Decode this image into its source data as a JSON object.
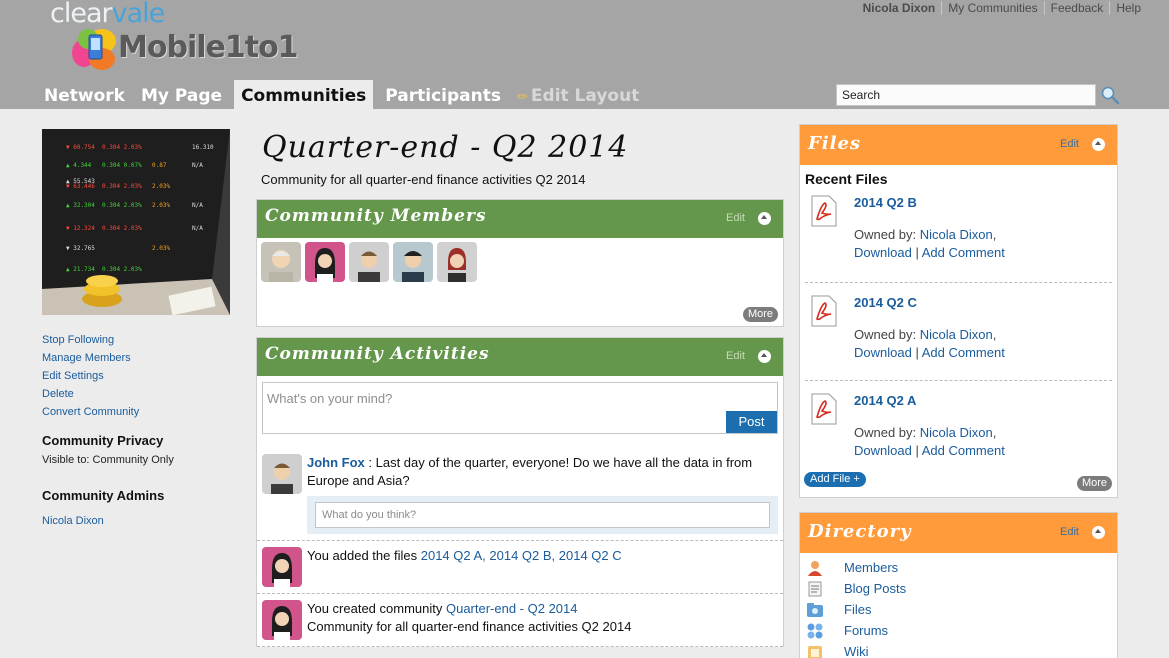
{
  "brand": {
    "top": "clear",
    "top_v": "vale",
    "main": "Mobile1to1"
  },
  "user_links": [
    "Nicola Dixon",
    "My Communities",
    "Feedback",
    "Help"
  ],
  "nav": {
    "tabs": [
      "Network",
      "My Page",
      "Communities",
      "Participants"
    ],
    "active": "Communities",
    "edit_layout": "Edit Layout"
  },
  "search": {
    "value": "Search"
  },
  "left": {
    "links": [
      "Stop Following",
      "Manage Members",
      "Edit Settings",
      "Delete",
      "Convert Community"
    ],
    "privacy_title": "Community Privacy",
    "privacy_value": "Visible to: Community Only",
    "admins_title": "Community Admins",
    "admin": "Nicola Dixon"
  },
  "community": {
    "title": "Quarter-end - Q2 2014",
    "subtitle": "Community for all quarter-end finance activities Q2 2014"
  },
  "members_panel": {
    "title": "Community Members",
    "edit": "Edit",
    "more": "More"
  },
  "activities_panel": {
    "title": "Community Activities",
    "edit": "Edit",
    "composer_placeholder": "What's on your mind?",
    "post_label": "Post",
    "reply_placeholder": "What do you think?",
    "items": [
      {
        "name": "John Fox",
        "text": " : Last day of the quarter, everyone! Do we have all the data in from Europe and Asia?"
      },
      {
        "prefix": "You added the files ",
        "links": "2014 Q2 A, 2014 Q2 B, 2014 Q2 C"
      },
      {
        "prefix": "You created community ",
        "links": "Quarter-end - Q2 2014",
        "line2": "Community for all quarter-end finance activities Q2 2014"
      }
    ]
  },
  "files_panel": {
    "title": "Files",
    "edit": "Edit",
    "heading": "Recent Files",
    "owned_by": "Owned by:",
    "owner": "Nicola Dixon",
    "download": "Download",
    "add_comment": "Add Comment",
    "files": [
      "2014 Q2 B",
      "2014 Q2 C",
      "2014 Q2 A"
    ],
    "add_file": "Add File +",
    "more": "More"
  },
  "directory_panel": {
    "title": "Directory",
    "edit": "Edit",
    "items": [
      "Members",
      "Blog Posts",
      "Files",
      "Forums",
      "Wiki"
    ]
  },
  "colors": {
    "green_header": "#64974b",
    "orange_header": "#ff9b3a",
    "link": "#1a5c9c",
    "button": "#1b6fb1"
  }
}
